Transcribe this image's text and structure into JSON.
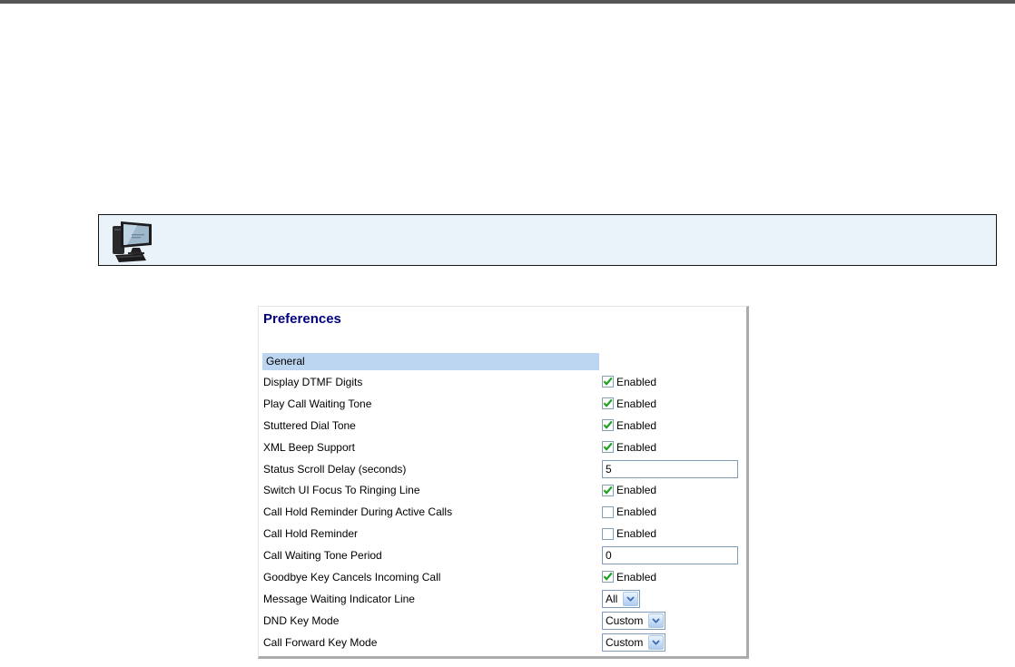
{
  "panel": {
    "title": "Preferences",
    "section": "General",
    "rows": [
      {
        "label": "Display DTMF Digits",
        "control": "checkbox",
        "checked": true,
        "text": "Enabled"
      },
      {
        "label": "Play Call Waiting Tone",
        "control": "checkbox",
        "checked": true,
        "text": "Enabled"
      },
      {
        "label": "Stuttered Dial Tone",
        "control": "checkbox",
        "checked": true,
        "text": "Enabled"
      },
      {
        "label": "XML Beep Support",
        "control": "checkbox",
        "checked": true,
        "text": "Enabled"
      },
      {
        "label": "Status Scroll Delay (seconds)",
        "control": "input",
        "value": "5"
      },
      {
        "label": "Switch UI Focus To Ringing Line",
        "control": "checkbox",
        "checked": true,
        "text": "Enabled"
      },
      {
        "label": "Call Hold Reminder During Active Calls",
        "control": "checkbox",
        "checked": false,
        "text": "Enabled"
      },
      {
        "label": "Call Hold Reminder",
        "control": "checkbox",
        "checked": false,
        "text": "Enabled"
      },
      {
        "label": "Call Waiting Tone Period",
        "control": "input",
        "value": "0"
      },
      {
        "label": "Goodbye Key Cancels Incoming Call",
        "control": "checkbox",
        "checked": true,
        "text": "Enabled"
      },
      {
        "label": "Message Waiting Indicator Line",
        "control": "select",
        "value": "All"
      },
      {
        "label": "DND Key Mode",
        "control": "select",
        "value": "Custom"
      },
      {
        "label": "Call Forward Key Mode",
        "control": "select",
        "value": "Custom"
      }
    ]
  },
  "banner": {
    "icon": "computer-icon"
  },
  "colors": {
    "title_navy": "#000080",
    "section_bar_bg": "#BCD6F2",
    "check_green": "#1EA01E",
    "control_border": "#7F9DB9",
    "select_arrow_blue": "#3A6BB5",
    "banner_bg": "#EBF3FA",
    "top_bar_gray": "#565656"
  }
}
